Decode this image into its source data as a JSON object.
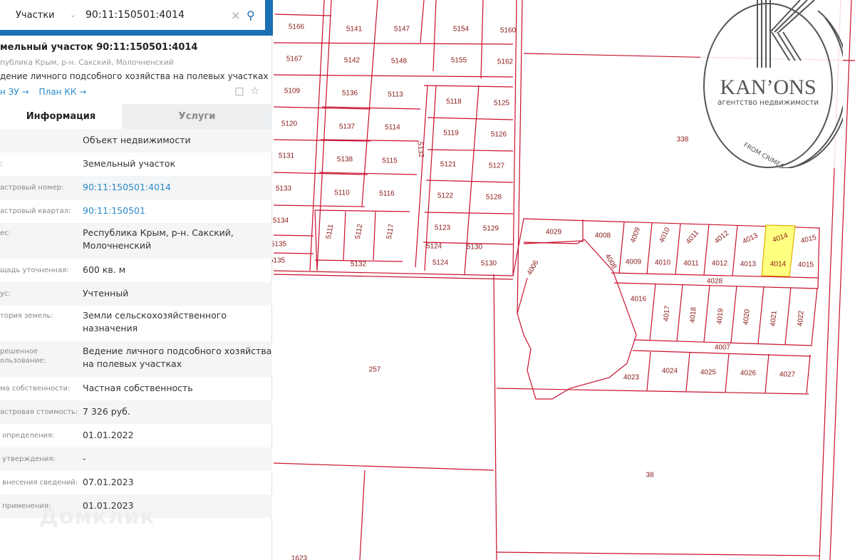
{
  "search": {
    "category": "Участки",
    "query": "90:11:150501:4014"
  },
  "header": {
    "title": "мельный участок 90:11:150501:4014",
    "address": "публика Крым, р-н. Сакский, Молочненский",
    "use": "дение личного подсобного хозяйства на полевых участках",
    "link_zu": "н ЗУ →",
    "link_kk": "План КК →"
  },
  "tabs": {
    "info": "Информация",
    "services": "Услуги"
  },
  "rows": [
    {
      "label": "",
      "value": "Объект недвижимости"
    },
    {
      "label": ":",
      "value": "Земельный участок"
    },
    {
      "label": "астровый номер:",
      "value": "90:11:150501:4014"
    },
    {
      "label": "астровый квартал:",
      "value": "90:11:150501"
    },
    {
      "label": "ес:",
      "value": "Республика Крым, р-н. Сакский, Молочненский"
    },
    {
      "label": "щадь уточненная:",
      "value": "600 кв. м"
    },
    {
      "label": "ус:",
      "value": "Учтенный"
    },
    {
      "label": "тория земель:",
      "value": "Земли сельскохозяйственного назначения"
    },
    {
      "label": "решенное\nользование:",
      "value": "Ведение личного подсобного хозяйства на полевых участках"
    },
    {
      "label": "ма собственности:",
      "value": "Частная собственность"
    },
    {
      "label": "астровая стоимость:",
      "value": "7 326 руб."
    },
    {
      "label": " определения:",
      "value": "01.01.2022"
    },
    {
      "label": " утверждения:",
      "value": "-"
    },
    {
      "label": " внесения сведений:",
      "value": "07.01.2023"
    },
    {
      "label": " применения:",
      "value": "01.01.2023"
    }
  ],
  "watermark": "Домклик",
  "logo": {
    "name": "KAN’ONS",
    "subtitle": "агентство недвижимости",
    "tagline": "FROM CRIMEA"
  },
  "colors": {
    "accent": "#1b6fb3",
    "parcel_line": "#c8102e",
    "selected": "#ffff80"
  },
  "map_labels": [
    "5166",
    "5141",
    "5147",
    "5154",
    "5160",
    "5167",
    "5142",
    "5148",
    "5155",
    "5162",
    "5109",
    "5136",
    "5113",
    "5118",
    "5125",
    "5120",
    "5137",
    "5114",
    "5119",
    "5126",
    "5131",
    "5138",
    "5115",
    "5121",
    "5127",
    "5133",
    "5110",
    "5116",
    "5122",
    "5128",
    "5134",
    "5111",
    "5112",
    "5117",
    "5123",
    "5129",
    "5135",
    "5135",
    "5124",
    "5130",
    "5132",
    "5124",
    "5130",
    "5132",
    "338",
    "257",
    "38",
    "1623",
    "4029",
    "4008",
    "4009",
    "4010",
    "4011",
    "4012",
    "4013",
    "4014",
    "4015",
    "4006",
    "4008",
    "4009",
    "4010",
    "4011",
    "4012",
    "4013",
    "4014",
    "4015",
    "4028",
    "4016",
    "4017",
    "4018",
    "4019",
    "4020",
    "4021",
    "4022",
    "4007",
    "4023",
    "4024",
    "4025",
    "4026",
    "4027"
  ]
}
